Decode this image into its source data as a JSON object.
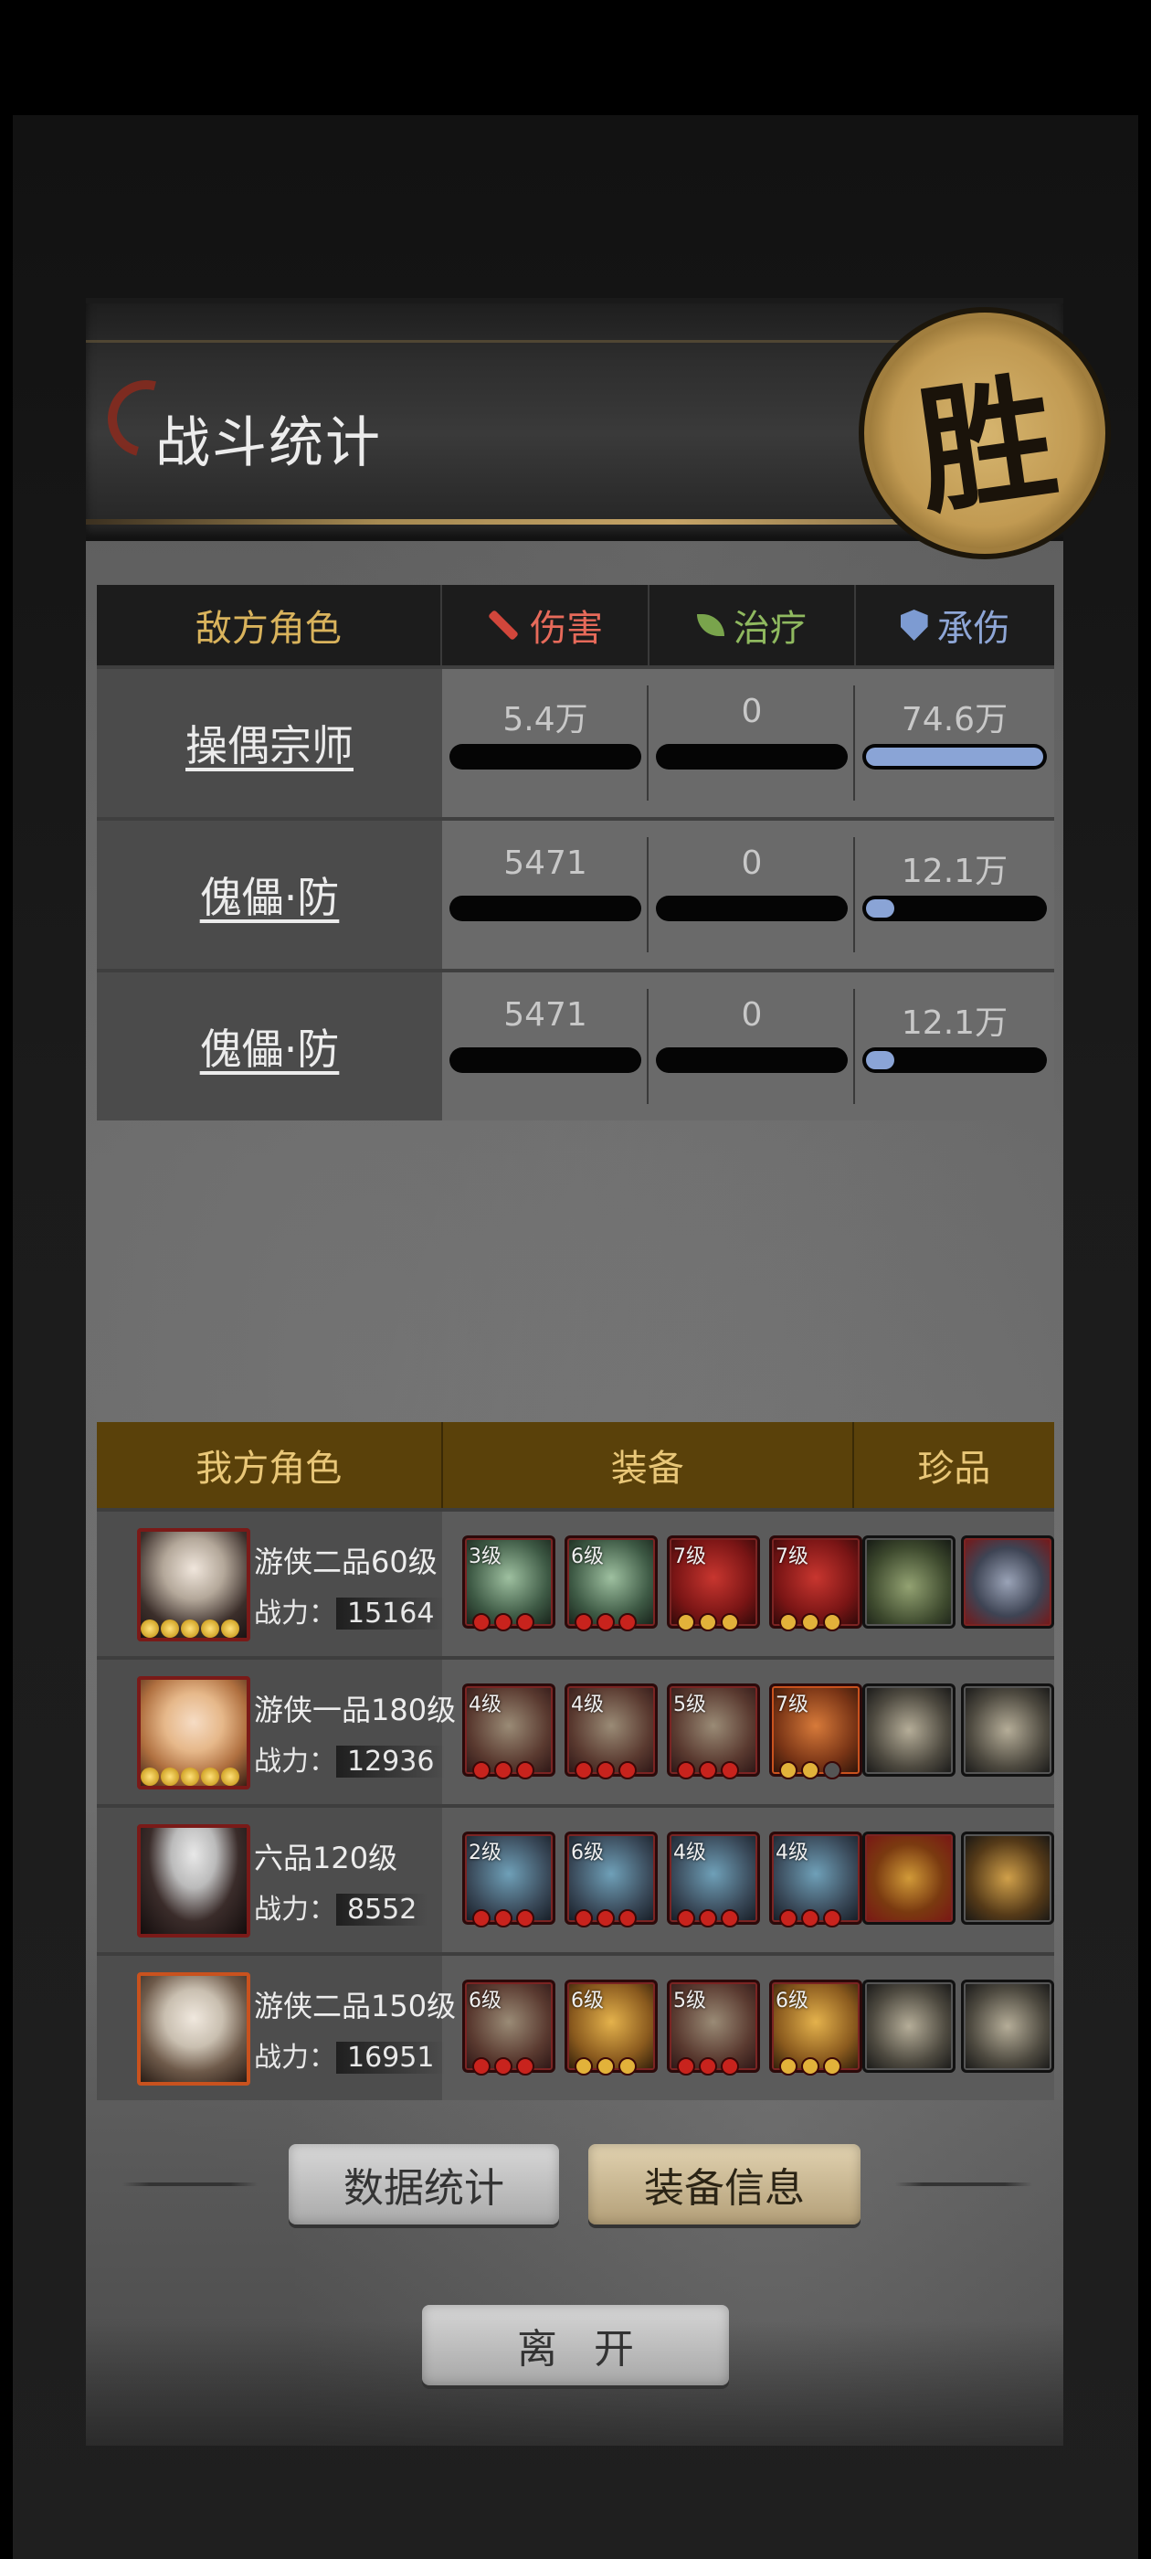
{
  "window": {
    "title": "战斗统计",
    "victory_seal": "胜"
  },
  "enemy_table": {
    "headers": {
      "role": "敌方角色",
      "damage": "伤害",
      "heal": "治疗",
      "taken": "承伤"
    },
    "rows": [
      {
        "name": "操偶宗师",
        "damage": "5.4万",
        "heal": "0",
        "taken": "74.6万",
        "damage_fill": 0,
        "heal_fill": 0,
        "taken_fill": 1.0
      },
      {
        "name": "傀儡·防",
        "damage": "5471",
        "heal": "0",
        "taken": "12.1万",
        "damage_fill": 0,
        "heal_fill": 0,
        "taken_fill": 0.16
      },
      {
        "name": "傀儡·防",
        "damage": "5471",
        "heal": "0",
        "taken": "12.1万",
        "damage_fill": 0,
        "heal_fill": 0,
        "taken_fill": 0.16
      }
    ]
  },
  "ally_table": {
    "headers": {
      "role": "我方角色",
      "equipment": "装备",
      "treasure": "珍品"
    },
    "power_label": "战力：",
    "rows": [
      {
        "title": "游侠二品60级",
        "power": "15164",
        "stars": 5,
        "equipment": [
          {
            "level": "3级",
            "icon": "gourd-icon"
          },
          {
            "level": "6级",
            "icon": "armor-icon"
          },
          {
            "level": "7级",
            "icon": "red-flower-icon"
          },
          {
            "level": "7级",
            "icon": "red-flower-icon"
          }
        ],
        "treasures": [
          "jade-bowl-icon",
          "stone-toad-icon"
        ]
      },
      {
        "title": "游侠一品180级",
        "power": "12936",
        "stars": 5,
        "equipment": [
          {
            "level": "4级",
            "icon": "crossbow-icon"
          },
          {
            "level": "4级",
            "icon": "helmet-icon"
          },
          {
            "level": "5级",
            "icon": "prayer-beads-icon"
          },
          {
            "level": "7级",
            "icon": "jade-pendant-icon"
          }
        ],
        "treasures": [
          "comb-icon",
          "comb-icon"
        ]
      },
      {
        "title": "六品120级",
        "power": "8552",
        "stars": 0,
        "equipment": [
          {
            "level": "2级",
            "icon": "sword-icon"
          },
          {
            "level": "6级",
            "icon": "robe-icon"
          },
          {
            "level": "4级",
            "icon": "owl-mask-icon"
          },
          {
            "level": "4级",
            "icon": "owl-mask-icon"
          }
        ],
        "treasures": [
          "beetle-icon",
          "hammer-icon"
        ]
      },
      {
        "title": "游侠二品150级",
        "power": "16951",
        "stars": 0,
        "equipment": [
          {
            "level": "6级",
            "icon": "crossbow-icon"
          },
          {
            "level": "6级",
            "icon": "pouch-icon"
          },
          {
            "level": "5级",
            "icon": "bell-icon"
          },
          {
            "level": "6级",
            "icon": "bracer-icon"
          }
        ],
        "treasures": [
          "comb-icon",
          "comb-icon"
        ]
      }
    ]
  },
  "buttons": {
    "stats": "数据统计",
    "equip_info": "装备信息",
    "leave": "离开"
  }
}
